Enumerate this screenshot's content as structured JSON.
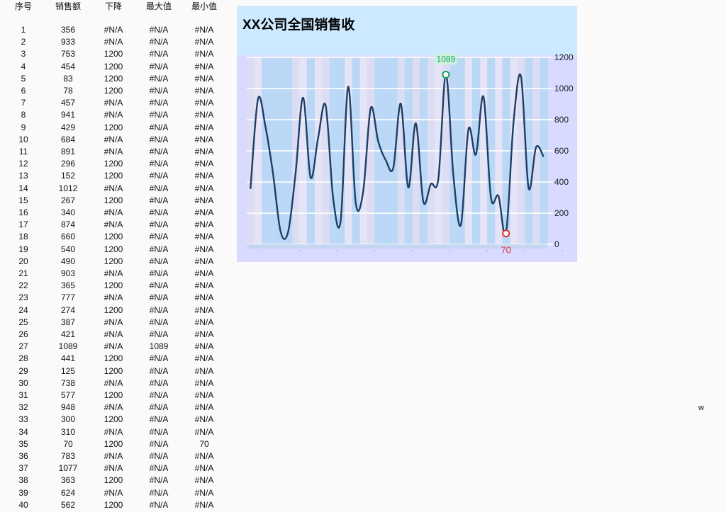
{
  "sheet": {
    "headers": [
      "序号",
      "销售额",
      "下降",
      "最大值",
      "最小值"
    ],
    "rows": [
      [
        "1",
        "356",
        "#N/A",
        "#N/A",
        "#N/A"
      ],
      [
        "2",
        "933",
        "#N/A",
        "#N/A",
        "#N/A"
      ],
      [
        "3",
        "753",
        "1200",
        "#N/A",
        "#N/A"
      ],
      [
        "4",
        "454",
        "1200",
        "#N/A",
        "#N/A"
      ],
      [
        "5",
        "83",
        "1200",
        "#N/A",
        "#N/A"
      ],
      [
        "6",
        "78",
        "1200",
        "#N/A",
        "#N/A"
      ],
      [
        "7",
        "457",
        "#N/A",
        "#N/A",
        "#N/A"
      ],
      [
        "8",
        "941",
        "#N/A",
        "#N/A",
        "#N/A"
      ],
      [
        "9",
        "429",
        "1200",
        "#N/A",
        "#N/A"
      ],
      [
        "10",
        "684",
        "#N/A",
        "#N/A",
        "#N/A"
      ],
      [
        "11",
        "891",
        "#N/A",
        "#N/A",
        "#N/A"
      ],
      [
        "12",
        "296",
        "1200",
        "#N/A",
        "#N/A"
      ],
      [
        "13",
        "152",
        "1200",
        "#N/A",
        "#N/A"
      ],
      [
        "14",
        "1012",
        "#N/A",
        "#N/A",
        "#N/A"
      ],
      [
        "15",
        "267",
        "1200",
        "#N/A",
        "#N/A"
      ],
      [
        "16",
        "340",
        "#N/A",
        "#N/A",
        "#N/A"
      ],
      [
        "17",
        "874",
        "#N/A",
        "#N/A",
        "#N/A"
      ],
      [
        "18",
        "660",
        "1200",
        "#N/A",
        "#N/A"
      ],
      [
        "19",
        "540",
        "1200",
        "#N/A",
        "#N/A"
      ],
      [
        "20",
        "490",
        "1200",
        "#N/A",
        "#N/A"
      ],
      [
        "21",
        "903",
        "#N/A",
        "#N/A",
        "#N/A"
      ],
      [
        "22",
        "365",
        "1200",
        "#N/A",
        "#N/A"
      ],
      [
        "23",
        "777",
        "#N/A",
        "#N/A",
        "#N/A"
      ],
      [
        "24",
        "274",
        "1200",
        "#N/A",
        "#N/A"
      ],
      [
        "25",
        "387",
        "#N/A",
        "#N/A",
        "#N/A"
      ],
      [
        "26",
        "421",
        "#N/A",
        "#N/A",
        "#N/A"
      ],
      [
        "27",
        "1089",
        "#N/A",
        "1089",
        "#N/A"
      ],
      [
        "28",
        "441",
        "1200",
        "#N/A",
        "#N/A"
      ],
      [
        "29",
        "125",
        "1200",
        "#N/A",
        "#N/A"
      ],
      [
        "30",
        "738",
        "#N/A",
        "#N/A",
        "#N/A"
      ],
      [
        "31",
        "577",
        "1200",
        "#N/A",
        "#N/A"
      ],
      [
        "32",
        "948",
        "#N/A",
        "#N/A",
        "#N/A"
      ],
      [
        "33",
        "300",
        "1200",
        "#N/A",
        "#N/A"
      ],
      [
        "34",
        "310",
        "#N/A",
        "#N/A",
        "#N/A"
      ],
      [
        "35",
        "70",
        "1200",
        "#N/A",
        "70"
      ],
      [
        "36",
        "783",
        "#N/A",
        "#N/A",
        "#N/A"
      ],
      [
        "37",
        "1077",
        "#N/A",
        "#N/A",
        "#N/A"
      ],
      [
        "38",
        "363",
        "1200",
        "#N/A",
        "#N/A"
      ],
      [
        "39",
        "624",
        "#N/A",
        "#N/A",
        "#N/A"
      ],
      [
        "40",
        "562",
        "1200",
        "#N/A",
        "#N/A"
      ]
    ]
  },
  "chart_data": {
    "type": "line",
    "title": "XX公司全国销售收",
    "x": [
      1,
      2,
      3,
      4,
      5,
      6,
      7,
      8,
      9,
      10,
      11,
      12,
      13,
      14,
      15,
      16,
      17,
      18,
      19,
      20,
      21,
      22,
      23,
      24,
      25,
      26,
      27,
      28,
      29,
      30,
      31,
      32,
      33,
      34,
      35,
      36,
      37,
      38,
      39,
      40
    ],
    "series": [
      {
        "values": [
          356,
          933,
          753,
          454,
          83,
          78,
          457,
          941,
          429,
          684,
          891,
          296,
          152,
          1012,
          267,
          340,
          874,
          660,
          540,
          490,
          903,
          365,
          777,
          274,
          387,
          421,
          1089,
          441,
          125,
          738,
          577,
          948,
          300,
          310,
          70,
          783,
          1077,
          363,
          624,
          562
        ]
      }
    ],
    "decline_bars": [
      null,
      null,
      1200,
      1200,
      1200,
      1200,
      null,
      null,
      1200,
      null,
      null,
      1200,
      1200,
      null,
      1200,
      null,
      null,
      1200,
      1200,
      1200,
      null,
      1200,
      null,
      1200,
      null,
      null,
      null,
      1200,
      1200,
      null,
      1200,
      null,
      1200,
      null,
      1200,
      null,
      null,
      1200,
      null,
      1200
    ],
    "max_point": {
      "x": 27,
      "value": 1089,
      "label": "1089"
    },
    "min_point": {
      "x": 35,
      "value": 70,
      "label": "70"
    },
    "yticks": [
      0,
      200,
      400,
      600,
      800,
      1000,
      1200
    ],
    "ylim": [
      0,
      1200
    ],
    "grid": true,
    "axis_position": "right",
    "colors": {
      "line": "#1d3f66",
      "bar": "#b5d6f7",
      "panel": "#d8dbff",
      "title_band": "#cde9ff",
      "max_marker": "#17a35a",
      "min_marker": "#e03333"
    }
  },
  "stray_text": "w"
}
